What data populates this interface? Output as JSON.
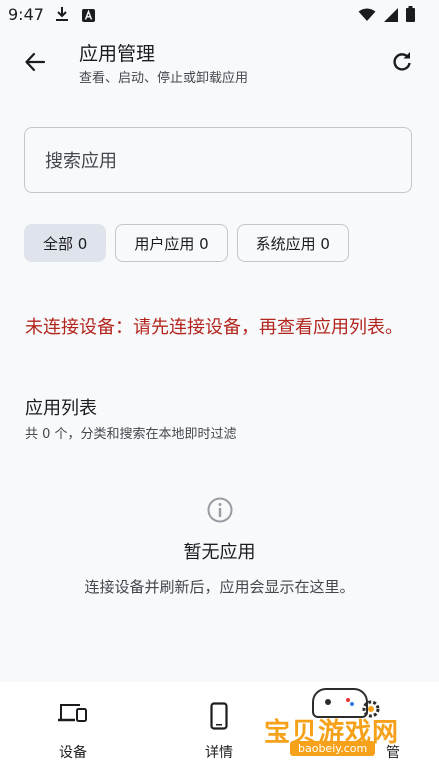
{
  "status_bar": {
    "time": "9:47",
    "icons": [
      "download-icon",
      "a-badge-icon",
      "wifi-icon",
      "signal-icon",
      "battery-icon"
    ]
  },
  "header": {
    "title": "应用管理",
    "subtitle": "查看、启动、停止或卸载应用",
    "back_icon": "arrow-left-icon",
    "refresh_icon": "refresh-icon"
  },
  "search": {
    "placeholder": "搜索应用",
    "value": ""
  },
  "filters": [
    {
      "label": "全部 0",
      "selected": true
    },
    {
      "label": "用户应用 0",
      "selected": false
    },
    {
      "label": "系统应用 0",
      "selected": false
    }
  ],
  "error_message": "未连接设备：请先连接设备，再查看应用列表。",
  "app_list": {
    "title": "应用列表",
    "subtitle": "共 0 个，分类和搜索在本地即时过滤"
  },
  "empty_state": {
    "icon": "info-icon",
    "title": "暂无应用",
    "description": "连接设备并刷新后，应用会显示在这里。"
  },
  "bottom_nav": [
    {
      "label": "设备",
      "icon": "devices-icon"
    },
    {
      "label": "详情",
      "icon": "phone-icon"
    },
    {
      "label": "管",
      "icon": "hidden-icon"
    }
  ],
  "watermark": {
    "text": "宝贝游戏网",
    "url": "baobeiy.com"
  },
  "colors": {
    "background": "#f8f9fb",
    "error": "#b3261e",
    "chip_selected": "#dfe3ec",
    "outline": "#c4c6cf",
    "watermark": "#f6a11a"
  }
}
